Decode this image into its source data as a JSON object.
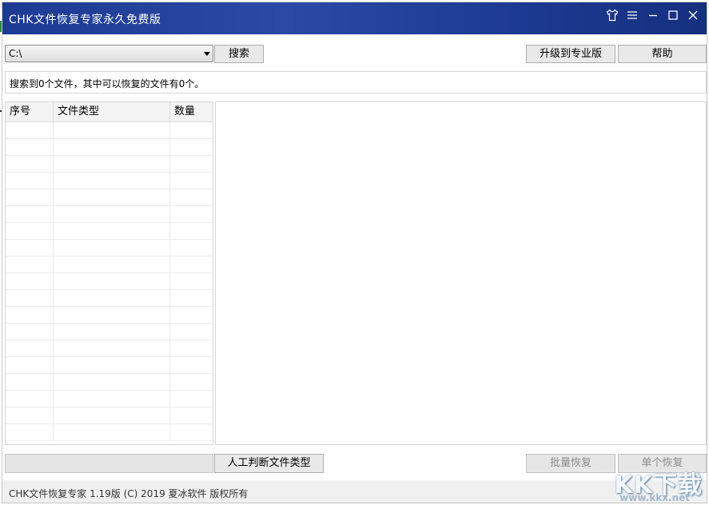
{
  "window": {
    "title": "CHK文件恢复专家永久免费版"
  },
  "titlebar_controls": [
    "skin-icon",
    "menu-icon",
    "minimize-icon",
    "maximize-icon",
    "close-icon"
  ],
  "toolbar": {
    "drive_value": "C:\\",
    "search_label": "搜索",
    "upgrade_label": "升级到专业版",
    "help_label": "帮助"
  },
  "status": {
    "text": "搜索到0个文件，其中可以恢复的文件有0个。"
  },
  "table": {
    "columns": [
      "序号",
      "文件类型",
      "数量"
    ],
    "rows": []
  },
  "bottom": {
    "path_value": "",
    "judge_label": "人工判断文件类型",
    "batch_recover_label": "批量恢复",
    "single_recover_label": "单个恢复"
  },
  "footer": {
    "text": "CHK文件恢复专家  1.19版  (C)  2019  夏冰软件  版权所有"
  },
  "watermark": {
    "logo": "KK下载",
    "url": "www.kkx.net"
  },
  "colors": {
    "titlebar": "#1e3b94",
    "accent_green": "#2e8b2e"
  }
}
